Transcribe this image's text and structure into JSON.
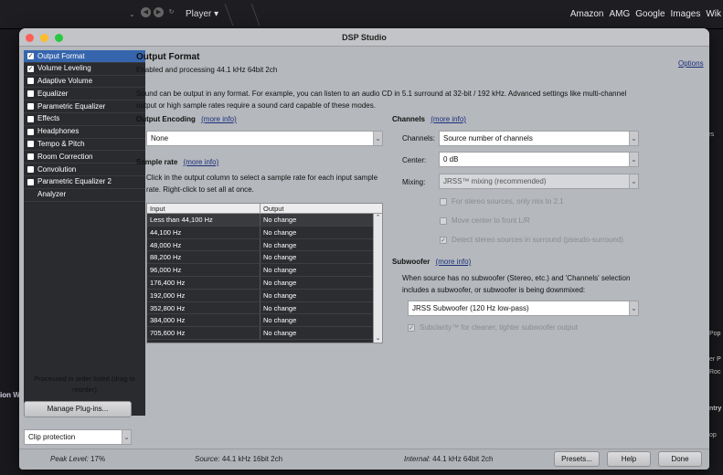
{
  "background": {
    "player_label": "Player ▾",
    "links": [
      "Amazon",
      "AMG",
      "Google",
      "Images",
      "Wik"
    ],
    "right_texts": [
      "pes",
      "Pop",
      "er P",
      "Roc",
      "ntry",
      "op"
    ],
    "left_text": "ion W"
  },
  "window": {
    "title": "DSP Studio"
  },
  "sidebar": {
    "items": [
      {
        "label": "Output Format",
        "checked": true,
        "selected": true
      },
      {
        "label": "Volume Leveling",
        "checked": true
      },
      {
        "label": "Adaptive Volume",
        "checked": false
      },
      {
        "label": "Equalizer",
        "checked": false
      },
      {
        "label": "Parametric Equalizer",
        "checked": false
      },
      {
        "label": "Effects",
        "checked": false
      },
      {
        "label": "Headphones",
        "checked": false
      },
      {
        "label": "Tempo & Pitch",
        "checked": false
      },
      {
        "label": "Room Correction",
        "checked": false
      },
      {
        "label": "Convolution",
        "checked": false
      },
      {
        "label": "Parametric Equalizer 2",
        "checked": false
      },
      {
        "label": "Analyzer",
        "checked": null
      }
    ],
    "processed_note": "Processed in order listed (drag to reorder)",
    "manage_button": "Manage Plug-ins...",
    "clip_protection": "Clip protection"
  },
  "main": {
    "title": "Output Format",
    "subtitle": "Enabled and processing 44.1 kHz 64bit 2ch",
    "options_link": "Options",
    "description": "Sound can be output in any format.  For example, you can listen to an audio CD in 5.1 surround at 32-bit / 192 kHz.  Advanced settings like multi-channel output or high sample rates require a sound card capable of these modes.",
    "more_info": "(more info)",
    "output_encoding": {
      "label": "Output Encoding",
      "value": "None"
    },
    "sample_rate": {
      "label": "Sample rate",
      "help": "Click in the output column to select a sample rate for each input sample rate.  Right-click to set all at once.",
      "columns": [
        "Input",
        "Output"
      ],
      "rows": [
        [
          "Less than 44,100 Hz",
          "No change"
        ],
        [
          "44,100 Hz",
          "No change"
        ],
        [
          "48,000 Hz",
          "No change"
        ],
        [
          "88,200 Hz",
          "No change"
        ],
        [
          "96,000 Hz",
          "No change"
        ],
        [
          "176,400 Hz",
          "No change"
        ],
        [
          "192,000 Hz",
          "No change"
        ],
        [
          "352,800 Hz",
          "No change"
        ],
        [
          "384,000 Hz",
          "No change"
        ],
        [
          "705,600 Hz",
          "No change"
        ]
      ]
    },
    "channels": {
      "label": "Channels",
      "channels_label": "Channels:",
      "channels_value": "Source number of channels",
      "center_label": "Center:",
      "center_value": "0 dB",
      "mixing_label": "Mixing:",
      "mixing_value": "JRSS™ mixing (recommended)",
      "opt_stereo": "For stereo sources, only mix to 2.1",
      "opt_center": "Move center to front L/R",
      "opt_detect": "Detect stereo sources in surround (pseudo-surround)"
    },
    "subwoofer": {
      "label": "Subwoofer",
      "help": "When source has no subwoofer (Stereo, etc.) and 'Channels' selection includes a subwoofer, or subwoofer is being downmixed:",
      "value": "JRSS Subwoofer (120 Hz low-pass)",
      "subclarity": "Subclarity™ for cleaner, tighter subwoofer output"
    }
  },
  "statusbar": {
    "peak_label": "Peak Level:",
    "peak_value": "17%",
    "source_label": "Source:",
    "source_value": "44.1 kHz 16bit 2ch",
    "internal_label": "Internal:",
    "internal_value": "44.1 kHz 64bit 2ch",
    "presets": "Presets...",
    "help": "Help",
    "done": "Done"
  }
}
